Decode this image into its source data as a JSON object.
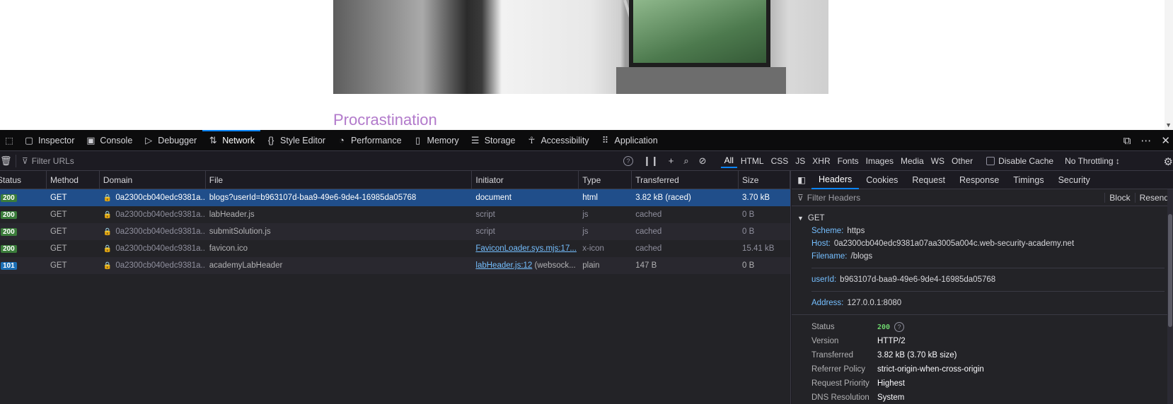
{
  "page": {
    "article_title": "Procrastination"
  },
  "devtools": {
    "tabs": [
      {
        "label": "Inspector",
        "icon": "inspector-icon"
      },
      {
        "label": "Console",
        "icon": "console-icon"
      },
      {
        "label": "Debugger",
        "icon": "debugger-icon"
      },
      {
        "label": "Network",
        "icon": "network-icon",
        "selected": true
      },
      {
        "label": "Style Editor",
        "icon": "style-editor-icon"
      },
      {
        "label": "Performance",
        "icon": "performance-icon"
      },
      {
        "label": "Memory",
        "icon": "memory-icon"
      },
      {
        "label": "Storage",
        "icon": "storage-icon"
      },
      {
        "label": "Accessibility",
        "icon": "accessibility-icon"
      },
      {
        "label": "Application",
        "icon": "application-icon"
      }
    ]
  },
  "network": {
    "filter_placeholder": "Filter URLs",
    "type_filters": [
      "All",
      "HTML",
      "CSS",
      "JS",
      "XHR",
      "Fonts",
      "Images",
      "Media",
      "WS",
      "Other"
    ],
    "active_type_filter": "All",
    "disable_cache_label": "Disable Cache",
    "throttling_label": "No Throttling ↕",
    "columns": [
      "Status",
      "Method",
      "Domain",
      "File",
      "Initiator",
      "Type",
      "Transferred",
      "Size"
    ],
    "rows": [
      {
        "status": "200",
        "method": "GET",
        "domain": "0a2300cb040edc9381a...",
        "file": "blogs?userId=b963107d-baa9-49e6-9de4-16985da05768",
        "initiator": "document",
        "initiator_extra": "",
        "type": "html",
        "transferred": "3.82 kB (raced)",
        "size": "3.70 kB"
      },
      {
        "status": "200",
        "method": "GET",
        "domain": "0a2300cb040edc9381a...",
        "file": "labHeader.js",
        "initiator": "script",
        "initiator_extra": "",
        "type": "js",
        "transferred": "cached",
        "size": "0 B"
      },
      {
        "status": "200",
        "method": "GET",
        "domain": "0a2300cb040edc9381a...",
        "file": "submitSolution.js",
        "initiator": "script",
        "initiator_extra": "",
        "type": "js",
        "transferred": "cached",
        "size": "0 B"
      },
      {
        "status": "200",
        "method": "GET",
        "domain": "0a2300cb040edc9381a...",
        "file": "favicon.ico",
        "initiator": "FaviconLoader.sys.mjs:17...",
        "initiator_extra": "",
        "type": "x-icon",
        "transferred": "cached",
        "size": "15.41 kB"
      },
      {
        "status": "101",
        "method": "GET",
        "domain": "0a2300cb040edc9381a...",
        "file": "academyLabHeader",
        "initiator": "labHeader.js:12",
        "initiator_extra": "(websock...",
        "type": "plain",
        "transferred": "147 B",
        "size": "0 B"
      }
    ]
  },
  "details": {
    "tabs": [
      "Headers",
      "Cookies",
      "Request",
      "Response",
      "Timings",
      "Security"
    ],
    "filter_placeholder": "Filter Headers",
    "block_label": "Block",
    "resend_label": "Resend",
    "method": "GET",
    "scheme_label": "Scheme:",
    "scheme": "https",
    "host_label": "Host:",
    "host": "0a2300cb040edc9381a07aa3005a004c.web-security-academy.net",
    "filename_label": "Filename:",
    "filename": "/blogs",
    "userid_label": "userId:",
    "userid": "b963107d-baa9-49e6-9de4-16985da05768",
    "address_label": "Address:",
    "address": "127.0.0.1:8080",
    "status_label": "Status",
    "status": "200",
    "version_label": "Version",
    "version": "HTTP/2",
    "transferred_label": "Transferred",
    "transferred": "3.82 kB (3.70 kB size)",
    "referrer_label": "Referrer Policy",
    "referrer": "strict-origin-when-cross-origin",
    "priority_label": "Request Priority",
    "priority": "Highest",
    "dns_label": "DNS Resolution",
    "dns": "System"
  }
}
